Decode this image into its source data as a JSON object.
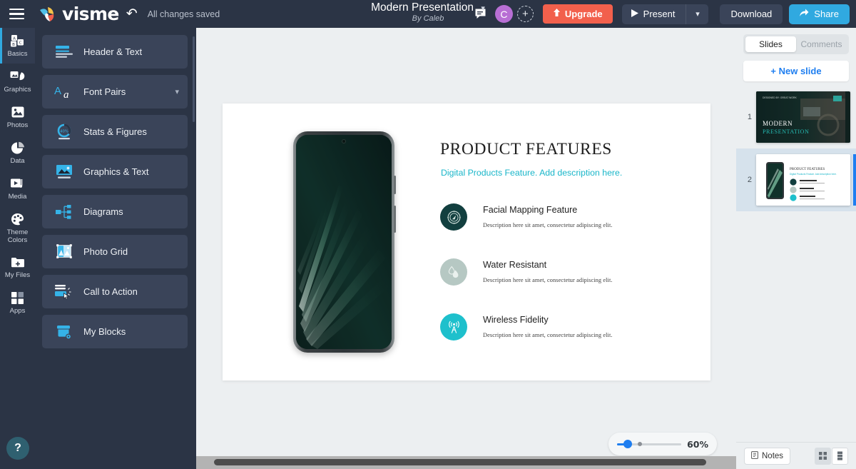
{
  "topbar": {
    "menu_icon": "hamburger-menu-icon",
    "brand": "visme",
    "undo_icon": "undo-icon",
    "save_status": "All changes saved",
    "doc_title": "Modern Presentation",
    "doc_author": "By Caleb",
    "comment_icon": "comment-icon",
    "avatar_initial": "C",
    "add_collaborator_icon": "add-user-icon",
    "upgrade_label": "Upgrade",
    "present_label": "Present",
    "download_label": "Download",
    "share_label": "Share",
    "accent_blue": "#30a9e0",
    "accent_red": "#f2604c",
    "avatar_color": "#b86fd4"
  },
  "rail": {
    "items": [
      {
        "label": "Basics",
        "icon": "blocks-icon",
        "active": true
      },
      {
        "label": "Graphics",
        "icon": "graphics-icon",
        "active": false
      },
      {
        "label": "Photos",
        "icon": "photo-icon",
        "active": false
      },
      {
        "label": "Data",
        "icon": "pie-chart-icon",
        "active": false
      },
      {
        "label": "Media",
        "icon": "video-icon",
        "active": false
      },
      {
        "label": "Theme Colors",
        "icon": "palette-icon",
        "active": false
      },
      {
        "label": "My Files",
        "icon": "folder-plus-icon",
        "active": false
      },
      {
        "label": "Apps",
        "icon": "grid-apps-icon",
        "active": false
      }
    ],
    "help_label": "?"
  },
  "panel": {
    "items": [
      {
        "label": "Header & Text",
        "icon": "header-text-icon",
        "caret": false
      },
      {
        "label": "Font Pairs",
        "icon": "font-pairs-icon",
        "caret": true
      },
      {
        "label": "Stats & Figures",
        "icon": "donut-chart-icon",
        "caret": false
      },
      {
        "label": "Graphics & Text",
        "icon": "image-text-icon",
        "caret": false
      },
      {
        "label": "Diagrams",
        "icon": "diagram-icon",
        "caret": false
      },
      {
        "label": "Photo Grid",
        "icon": "photo-grid-icon",
        "caret": false
      },
      {
        "label": "Call to Action",
        "icon": "call-to-action-icon",
        "caret": false
      },
      {
        "label": "My Blocks",
        "icon": "my-blocks-icon",
        "caret": false
      }
    ],
    "donut_value": "40%"
  },
  "slide": {
    "title": "PRODUCT FEATURES",
    "subtitle": "Digital Products Feature. Add description here.",
    "subtitle_color": "#19b6c9",
    "device_icon": "smartphone-mockup",
    "features": [
      {
        "heading": "Facial Mapping Feature",
        "desc": "Description here sit amet, consectetur adipiscing elit.",
        "icon": "compass-icon",
        "color": "#123f3f",
        "glyph_color": "#d8e6e2"
      },
      {
        "heading": "Water Resistant",
        "desc": "Description here sit amet, consectetur adipiscing elit.",
        "icon": "water-drop-icon",
        "color": "#b6c8c3",
        "glyph_color": "#e7efec"
      },
      {
        "heading": "Wireless Fidelity",
        "desc": "Description here sit amet, consectetur adipiscing elit.",
        "icon": "wifi-tower-icon",
        "color": "#1ec0cc",
        "glyph_color": "#ffffff"
      }
    ]
  },
  "zoom": {
    "value": "60%",
    "slider_color": "#1e7ef0"
  },
  "rightpanel": {
    "tabs": [
      {
        "label": "Slides",
        "active": true
      },
      {
        "label": "Comments",
        "active": false
      }
    ],
    "new_slide_label": "+ New slide",
    "slides": [
      {
        "number": "1",
        "selected": false,
        "title_line1": "MODERN",
        "title_line2": "PRESENTATION",
        "eyebrow": "DESIGNED BY: GREAT WORK"
      },
      {
        "number": "2",
        "selected": true,
        "title_line1": "PRODUCT FEATURES",
        "title_line2": "Digital Products Feature. Add description here.",
        "eyebrow": ""
      }
    ],
    "notes_label": "Notes",
    "notes_icon": "notes-icon",
    "grid_view_icon": "grid-view-icon",
    "list_view_icon": "list-view-icon"
  }
}
